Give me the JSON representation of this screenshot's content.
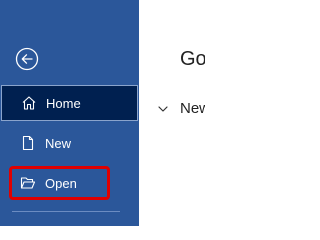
{
  "sidebar": {
    "back_icon": "back-arrow-icon",
    "items": [
      {
        "label": "Home",
        "icon": "home-icon",
        "selected": true
      },
      {
        "label": "New",
        "icon": "new-document-icon",
        "selected": false
      },
      {
        "label": "Open",
        "icon": "open-folder-icon",
        "selected": false,
        "highlighted": true
      }
    ]
  },
  "main": {
    "title": "Go",
    "section_label": "New"
  },
  "colors": {
    "sidebar_bg": "#2b579a",
    "selected_bg": "#002050",
    "highlight_border": "#e00000"
  }
}
